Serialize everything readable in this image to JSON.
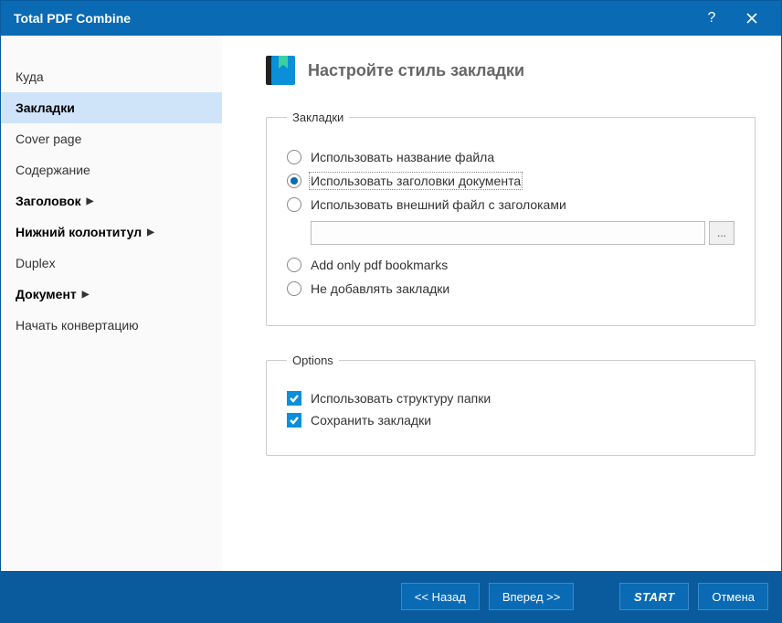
{
  "title": "Total PDF Combine",
  "sidebar": {
    "items": [
      {
        "label": "Куда",
        "bold": false,
        "expand": false
      },
      {
        "label": "Закладки",
        "bold": true,
        "expand": false,
        "active": true
      },
      {
        "label": "Cover page",
        "bold": false,
        "expand": false
      },
      {
        "label": "Содержание",
        "bold": false,
        "expand": false
      },
      {
        "label": "Заголовок",
        "bold": true,
        "expand": true
      },
      {
        "label": "Нижний колонтитул",
        "bold": true,
        "expand": true
      },
      {
        "label": "Duplex",
        "bold": false,
        "expand": false
      },
      {
        "label": "Документ",
        "bold": true,
        "expand": true
      },
      {
        "label": "Начать конвертацию",
        "bold": false,
        "expand": false
      }
    ]
  },
  "page": {
    "heading": "Настройте стиль закладки",
    "bookmarks_legend": "Закладки",
    "options_legend": "Options",
    "radios": {
      "filename": "Использовать название файла",
      "doc_headings": "Использовать заголовки документа",
      "external_file": "Использовать внешний файл с заголоками",
      "pdf_only": "Add only pdf bookmarks",
      "none": "Не добавлять закладки",
      "selected": "doc_headings"
    },
    "file_browse": "...",
    "checks": {
      "folder_structure": {
        "label": "Использовать структуру папки",
        "checked": true
      },
      "keep_bookmarks": {
        "label": "Сохранить закладки",
        "checked": true
      }
    }
  },
  "footer": {
    "back": "<<  Назад",
    "forward": "Вперед  >>",
    "start": "START",
    "cancel": "Отмена"
  }
}
